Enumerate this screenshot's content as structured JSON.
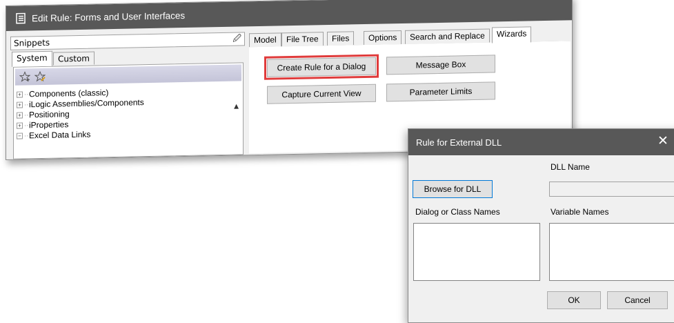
{
  "edit_rule": {
    "title": "Edit Rule: Forms and User Interfaces",
    "snippets": {
      "header": "Snippets",
      "tabs": [
        "System",
        "Custom"
      ],
      "tree": [
        "Components (classic)",
        "iLogic Assemblies/Components",
        "Positioning",
        "iProperties",
        "Excel Data Links"
      ]
    },
    "tabs": [
      "Model",
      "File Tree",
      "Files",
      "Options",
      "Search and Replace",
      "Wizards"
    ],
    "wizards": {
      "create_rule_dialog": "Create Rule for a Dialog",
      "message_box": "Message Box",
      "capture_current_view": "Capture Current View",
      "parameter_limits": "Parameter Limits"
    }
  },
  "dll_dialog": {
    "title": "Rule for External DLL",
    "dll_name_label": "DLL Name",
    "browse_button": "Browse for DLL",
    "dialog_class_label": "Dialog or Class Names",
    "variable_names_label": "Variable Names",
    "ok_button": "OK",
    "cancel_button": "Cancel"
  },
  "colors": {
    "titlebar": "#585858",
    "highlight": "#e03b3b",
    "focus": "#0078d7"
  }
}
